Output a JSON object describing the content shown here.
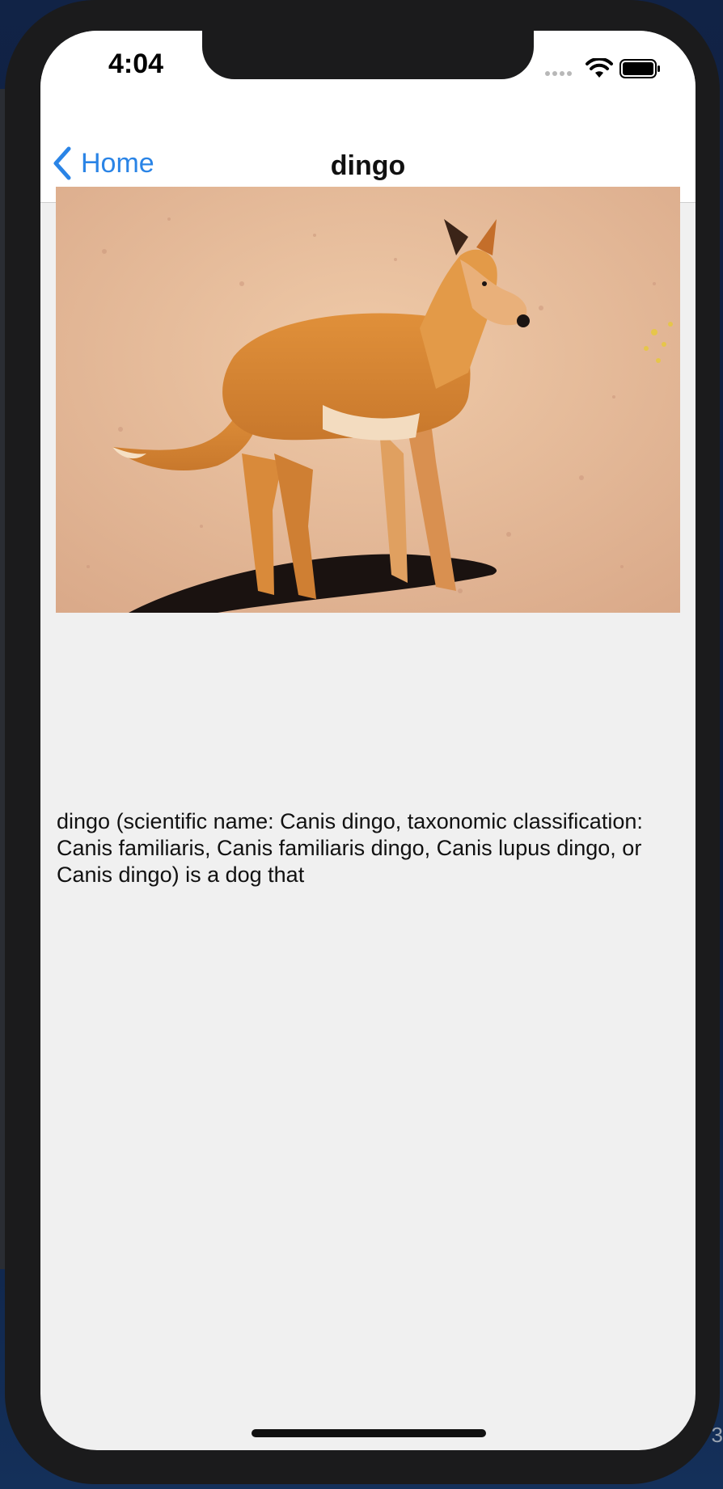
{
  "status_bar": {
    "time": "4:04",
    "wifi_icon": "wifi-icon",
    "battery_icon": "battery-icon"
  },
  "nav": {
    "back_label": "Home",
    "back_icon": "chevron-left-icon",
    "title": "dingo",
    "accent_color": "#2a84e6"
  },
  "content": {
    "image_subject": "dingo standing on gravel ground",
    "description": "dingo (scientific name: Canis dingo, taxonomic classification: Canis familiaris, Canis familiaris dingo, Canis lupus dingo, or Canis dingo) is a dog that"
  }
}
